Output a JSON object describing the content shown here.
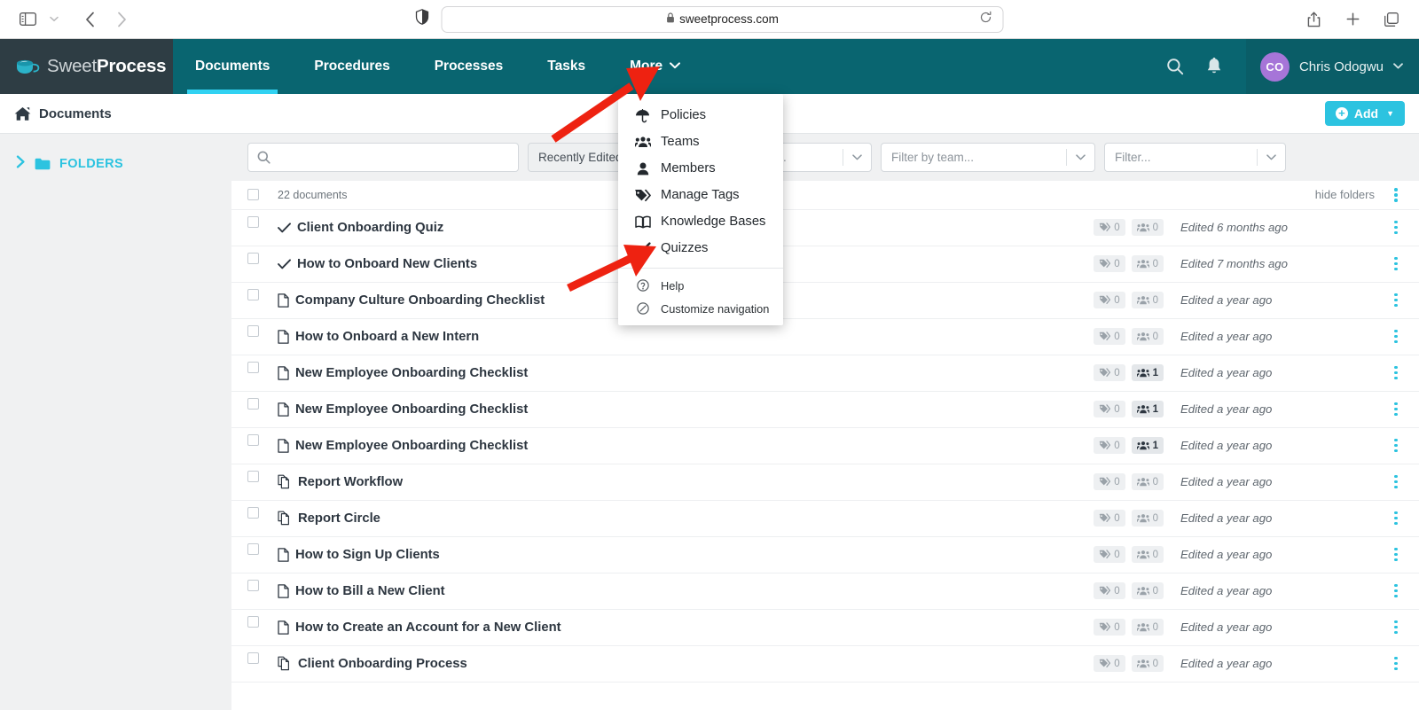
{
  "browser": {
    "url": "sweetprocess.com",
    "icons": {
      "sidebar_toggle": "sidebar-toggle-icon",
      "tab_overview": "chevron-down-icon",
      "back": "back-arrow-icon",
      "forward": "forward-arrow-icon",
      "shield": "privacy-shield-icon",
      "lock": "lock-icon",
      "reload": "reload-icon",
      "share": "share-icon",
      "new_tab": "plus-icon",
      "tabs": "tab-overview-icon"
    }
  },
  "navbar": {
    "logo": {
      "part1": "Sweet",
      "part2": "Process",
      "icon": "coffee-cup-icon"
    },
    "tabs": [
      {
        "label": "Documents",
        "active": true,
        "has_caret": false
      },
      {
        "label": "Procedures",
        "active": false,
        "has_caret": false
      },
      {
        "label": "Processes",
        "active": false,
        "has_caret": false
      },
      {
        "label": "Tasks",
        "active": false,
        "has_caret": false
      },
      {
        "label": "More",
        "active": false,
        "has_caret": true
      }
    ],
    "search_icon": "search-icon",
    "bell_icon": "notification-bell-icon",
    "user": {
      "initials": "CO",
      "name": "Chris Odogwu",
      "avatar_color": "#a675d8"
    }
  },
  "more_menu": {
    "items": [
      {
        "label": "Policies",
        "icon": "umbrella-icon"
      },
      {
        "label": "Teams",
        "icon": "users-group-icon"
      },
      {
        "label": "Members",
        "icon": "user-icon"
      },
      {
        "label": "Manage Tags",
        "icon": "tags-icon"
      },
      {
        "label": "Knowledge Bases",
        "icon": "book-open-icon"
      },
      {
        "label": "Quizzes",
        "icon": "check-icon"
      }
    ],
    "footer_items": [
      {
        "label": "Help",
        "icon": "question-circle-icon"
      },
      {
        "label": "Customize navigation",
        "icon": "compass-icon"
      }
    ]
  },
  "breadcrumb": {
    "home_icon": "home-icon",
    "label": "Documents",
    "add_button": {
      "label": "Add",
      "icon": "plus-circle-icon",
      "caret": "caret-down-icon"
    }
  },
  "sidebar": {
    "folders": {
      "label": "FOLDERS",
      "chevron": "chevron-right-icon",
      "icon": "folder-icon"
    }
  },
  "filters": {
    "search": {
      "placeholder": "",
      "value": "",
      "icon": "search-icon"
    },
    "sort": {
      "value": "Recently Edited"
    },
    "tag": {
      "value": "Filter by tag..."
    },
    "team": {
      "value": "Filter by team..."
    },
    "other": {
      "value": "Filter..."
    }
  },
  "list": {
    "count_label": "22 documents",
    "hide_folders_label": "hide folders",
    "rows": [
      {
        "title": "Client Onboarding Quiz",
        "icon": "check-icon",
        "tags": "0",
        "teams": "0",
        "teams_active": false,
        "edited": "Edited 6 months ago"
      },
      {
        "title": "How to Onboard New Clients",
        "icon": "check-icon",
        "tags": "0",
        "teams": "0",
        "teams_active": false,
        "edited": "Edited 7 months ago"
      },
      {
        "title": "Company Culture Onboarding Checklist",
        "icon": "document-icon",
        "tags": "0",
        "teams": "0",
        "teams_active": false,
        "edited": "Edited a year ago"
      },
      {
        "title": "How to Onboard a New Intern",
        "icon": "document-icon",
        "tags": "0",
        "teams": "0",
        "teams_active": false,
        "edited": "Edited a year ago"
      },
      {
        "title": "New Employee Onboarding Checklist",
        "icon": "document-icon",
        "tags": "0",
        "teams": "1",
        "teams_active": true,
        "edited": "Edited a year ago"
      },
      {
        "title": "New Employee Onboarding Checklist",
        "icon": "document-icon",
        "tags": "0",
        "teams": "1",
        "teams_active": true,
        "edited": "Edited a year ago"
      },
      {
        "title": "New Employee Onboarding Checklist",
        "icon": "document-icon",
        "tags": "0",
        "teams": "1",
        "teams_active": true,
        "edited": "Edited a year ago"
      },
      {
        "title": "Report Workflow",
        "icon": "process-icon",
        "tags": "0",
        "teams": "0",
        "teams_active": false,
        "edited": "Edited a year ago"
      },
      {
        "title": "Report Circle",
        "icon": "process-icon",
        "tags": "0",
        "teams": "0",
        "teams_active": false,
        "edited": "Edited a year ago"
      },
      {
        "title": "How to Sign Up Clients",
        "icon": "document-icon",
        "tags": "0",
        "teams": "0",
        "teams_active": false,
        "edited": "Edited a year ago"
      },
      {
        "title": "How to Bill a New Client",
        "icon": "document-icon",
        "tags": "0",
        "teams": "0",
        "teams_active": false,
        "edited": "Edited a year ago"
      },
      {
        "title": "How to Create an Account for a New Client",
        "icon": "document-icon",
        "tags": "0",
        "teams": "0",
        "teams_active": false,
        "edited": "Edited a year ago"
      },
      {
        "title": "Client Onboarding Process",
        "icon": "process-icon",
        "tags": "0",
        "teams": "0",
        "teams_active": false,
        "edited": "Edited a year ago"
      }
    ]
  },
  "annotations": {
    "arrow_color": "#ee2211",
    "arrows": [
      {
        "name": "arrow-to-more-menu"
      },
      {
        "name": "arrow-to-quizzes"
      }
    ]
  },
  "colors": {
    "nav_teal": "#096570",
    "logo_dark": "#2e3d44",
    "accent_cyan": "#2cc3e0",
    "active_underline": "#31d2f2"
  }
}
